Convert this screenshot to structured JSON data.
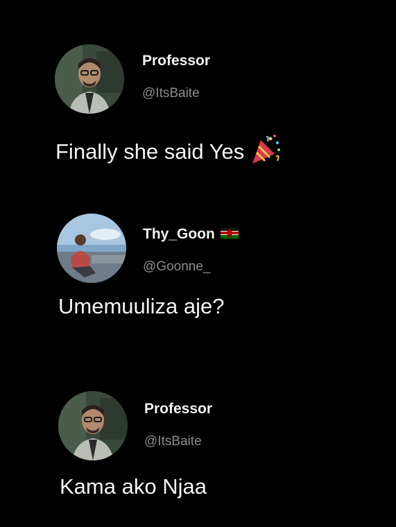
{
  "tweets": [
    {
      "display_name": "Professor",
      "handle": "@ItsBaite",
      "text": "Finally she said Yes",
      "emoji": "party-popper-icon"
    },
    {
      "display_name": "Thy_Goon",
      "handle": "@Goonne_",
      "text": "Umemuuliza aje?",
      "flag": "kenya-flag-icon"
    },
    {
      "display_name": "Professor",
      "handle": "@ItsBaite",
      "text": "Kama ako Njaa"
    }
  ],
  "colors": {
    "background": "#000000",
    "name": "#f2f2f2",
    "handle": "#8b8b8b",
    "text": "#f4f4f4"
  }
}
